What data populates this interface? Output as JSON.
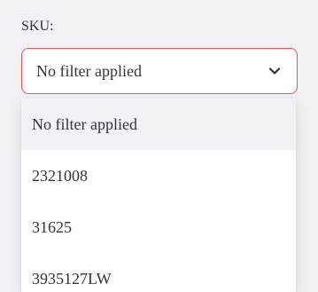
{
  "filter": {
    "label": "SKU:",
    "selected_value": "No filter applied",
    "accent_color": "#ff4b4b",
    "icon": "chevron-down-icon",
    "options": [
      {
        "label": "No filter applied"
      },
      {
        "label": "2321008"
      },
      {
        "label": "31625"
      },
      {
        "label": "3935127LW"
      }
    ]
  }
}
